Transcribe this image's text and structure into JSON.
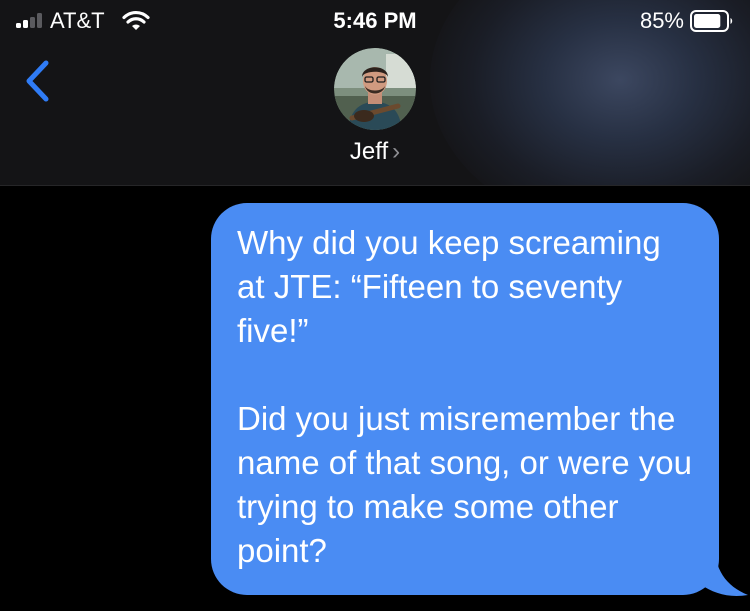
{
  "status_bar": {
    "carrier": "AT&T",
    "time": "5:46 PM",
    "battery_percent": "85%",
    "battery_level": 0.85,
    "signal_bars": 2,
    "icons": [
      "signal-icon",
      "wifi-icon",
      "battery-icon"
    ]
  },
  "header": {
    "back_icon": "chevron-left-icon",
    "contact_name": "Jeff",
    "contact_chevron": "›"
  },
  "messages": [
    {
      "direction": "outgoing",
      "paragraphs": [
        "Why did you keep screaming at JTE: “Fifteen to seventy five!”",
        "Did you just misremember the name of that song, or were you trying to make some other point?"
      ]
    }
  ],
  "colors": {
    "accent": "#2f7cf6",
    "bubble": "#4a8cf3",
    "background": "#000000",
    "header_bg": "#141416"
  }
}
